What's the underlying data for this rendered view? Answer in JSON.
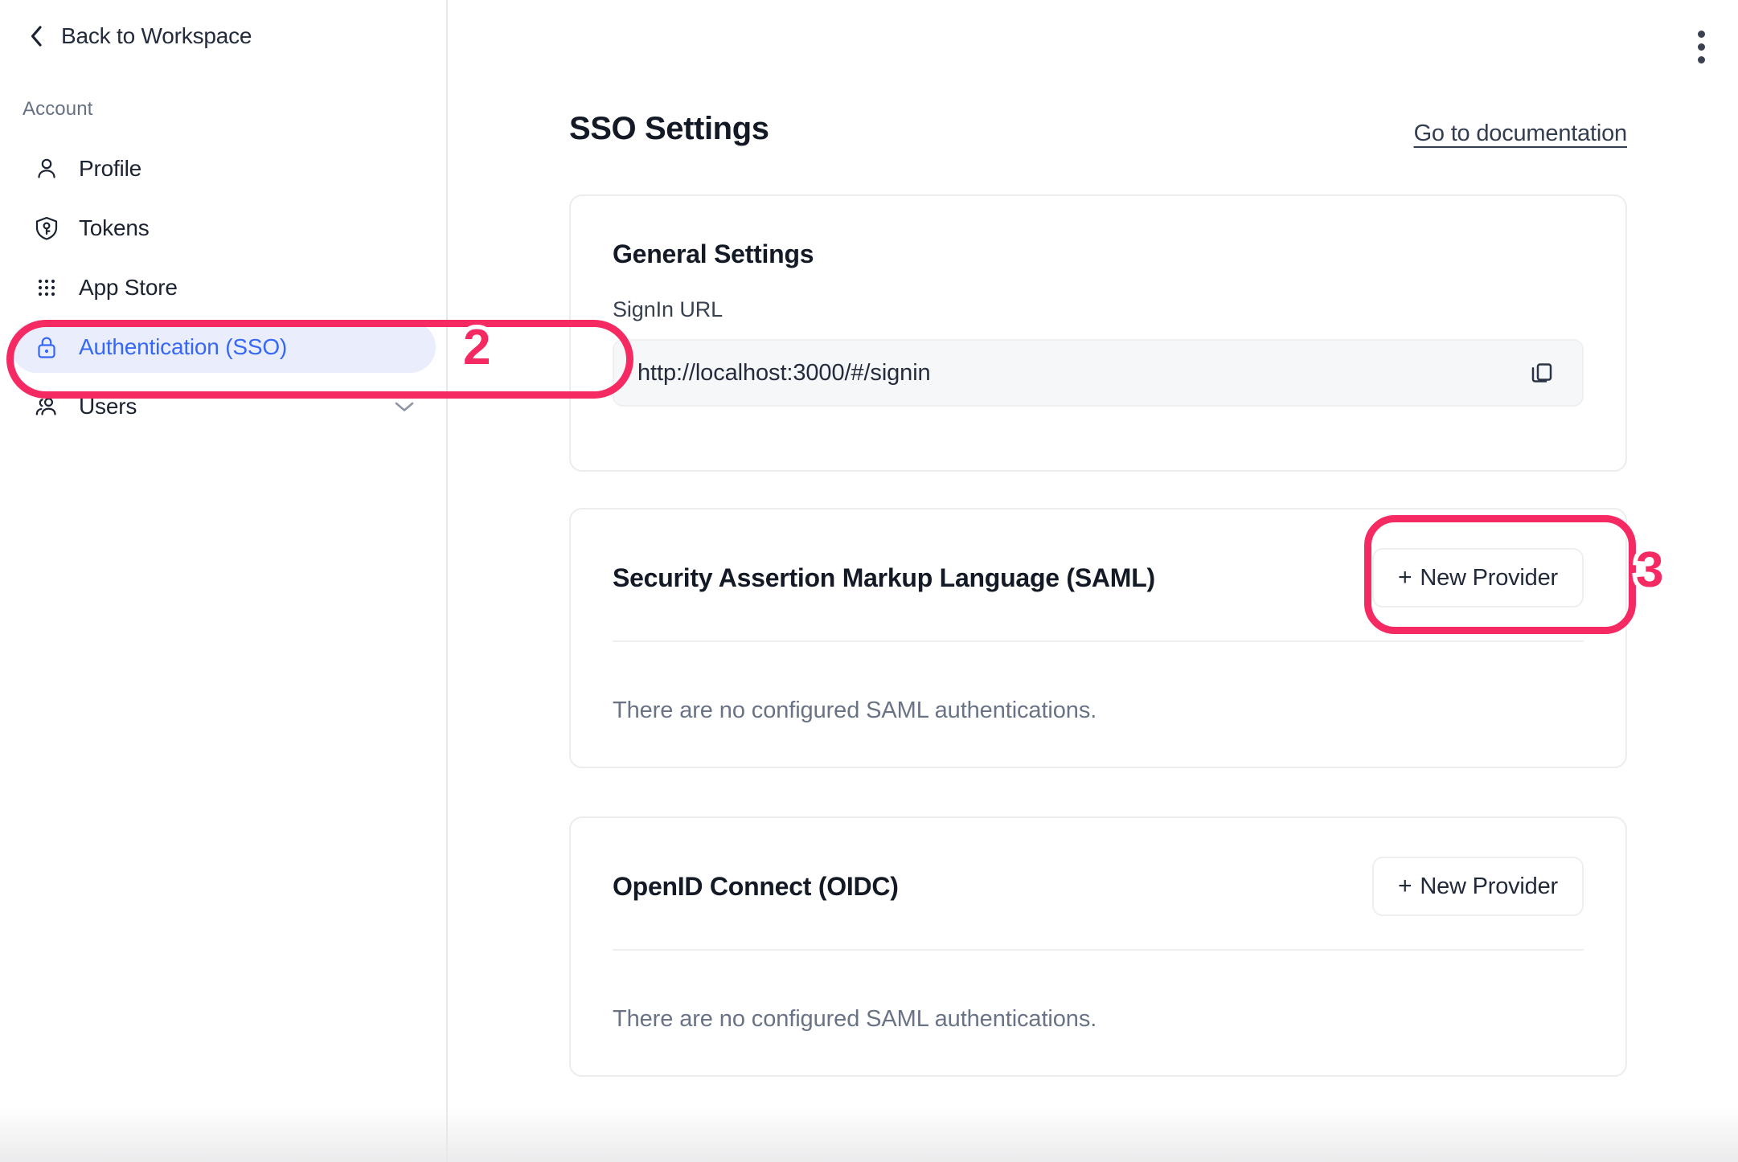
{
  "sidebar": {
    "back_label": "Back to Workspace",
    "back_icon": "chevron-left-icon",
    "section_label": "Account",
    "items": [
      {
        "label": "Profile",
        "icon": "user-icon",
        "active": false,
        "trailing": ""
      },
      {
        "label": "Tokens",
        "icon": "shield-key-icon",
        "active": false,
        "trailing": ""
      },
      {
        "label": "App Store",
        "icon": "grid-dots-icon",
        "active": false,
        "trailing": ""
      },
      {
        "label": "Authentication (SSO)",
        "icon": "lock-icon",
        "active": true,
        "trailing": ""
      },
      {
        "label": "Users",
        "icon": "users-icon",
        "active": false,
        "trailing": "chevron-down-icon"
      }
    ]
  },
  "header": {
    "title": "SSO Settings",
    "doc_link": "Go to documentation",
    "kebab_icon": "more-vertical-icon"
  },
  "general": {
    "title": "General Settings",
    "field_label": "SignIn URL",
    "url_value": "http://localhost:3000/#/signin",
    "copy_icon": "copy-icon"
  },
  "saml": {
    "title": "Security Assertion Markup Language (SAML)",
    "new_provider_label": "New Provider",
    "new_provider_plus": "+",
    "empty_text": "There are no configured SAML authentications."
  },
  "oidc": {
    "title": "OpenID Connect (OIDC)",
    "new_provider_label": "New Provider",
    "new_provider_plus": "+",
    "empty_text": "There are no configured SAML authentications."
  },
  "annotations": {
    "color": "#f62a63",
    "badge_2": "2",
    "badge_3": "3"
  },
  "colors": {
    "accent_blue": "#3768f5",
    "active_bg": "#e9edfc",
    "annotation": "#f62a63",
    "text_dark": "#131925",
    "text_muted": "#6a7385",
    "card_border": "#eceded"
  }
}
